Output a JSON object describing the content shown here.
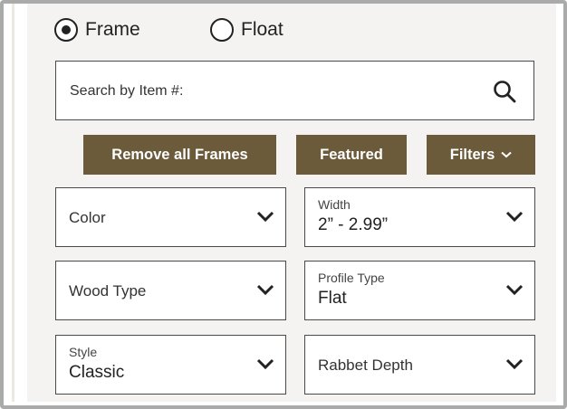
{
  "mount_type": {
    "options": [
      {
        "label": "Frame",
        "selected": true
      },
      {
        "label": "Float",
        "selected": false
      }
    ]
  },
  "search": {
    "placeholder": "Search by Item #:",
    "icon": "search-icon"
  },
  "buttons": {
    "remove_all": "Remove all Frames",
    "featured": "Featured",
    "filters": "Filters",
    "filters_icon": "chevron-down-icon",
    "color": "#6b5b3a"
  },
  "filters": {
    "color": {
      "label": "Color",
      "value": ""
    },
    "width": {
      "label": "Width",
      "value": "2” - 2.99”"
    },
    "wood_type": {
      "label": "Wood Type",
      "value": ""
    },
    "profile_type": {
      "label": "Profile Type",
      "value": "Flat"
    },
    "style": {
      "label": "Style",
      "value": "Classic"
    },
    "rabbet_depth": {
      "label": "Rabbet Depth",
      "value": ""
    }
  }
}
